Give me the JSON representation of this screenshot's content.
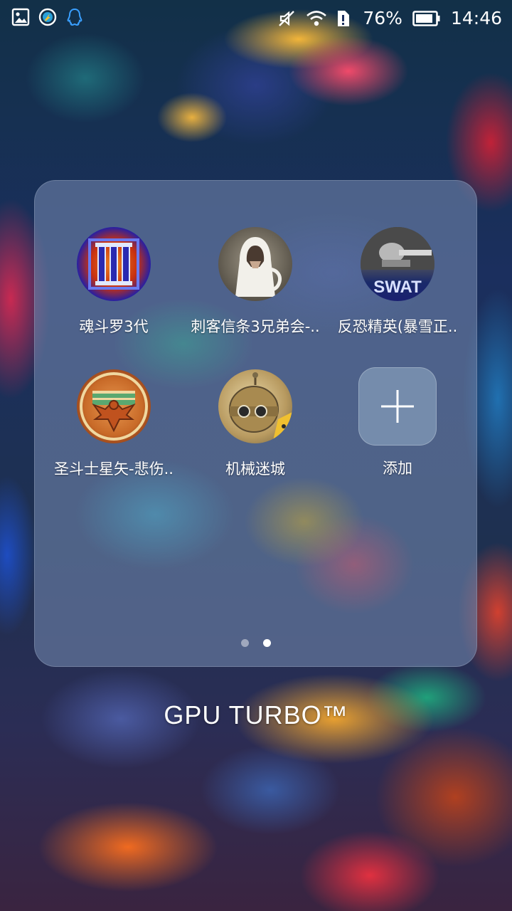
{
  "status_bar": {
    "left_icons": [
      "gallery-icon",
      "browser-icon",
      "qq-icon"
    ],
    "right_icons": [
      "mute-icon",
      "wifi-icon",
      "sim-alert-icon",
      "battery-icon"
    ],
    "battery_percent": "76%",
    "time": "14:46"
  },
  "folder": {
    "apps": [
      {
        "label": "魂斗罗3代",
        "icon": "contra3-icon"
      },
      {
        "label": "刺客信条3兄弟会-..",
        "icon": "assassins-creed-icon"
      },
      {
        "label": "反恐精英(暴雪正..",
        "icon": "counter-strike-icon"
      },
      {
        "label": "圣斗士星矢-悲伤..",
        "icon": "saint-seiya-icon"
      },
      {
        "label": "机械迷城",
        "icon": "machinarium-icon"
      }
    ],
    "add_label": "添加",
    "page_count": 2,
    "current_page": 2,
    "title": "GPU  TURBO™"
  }
}
